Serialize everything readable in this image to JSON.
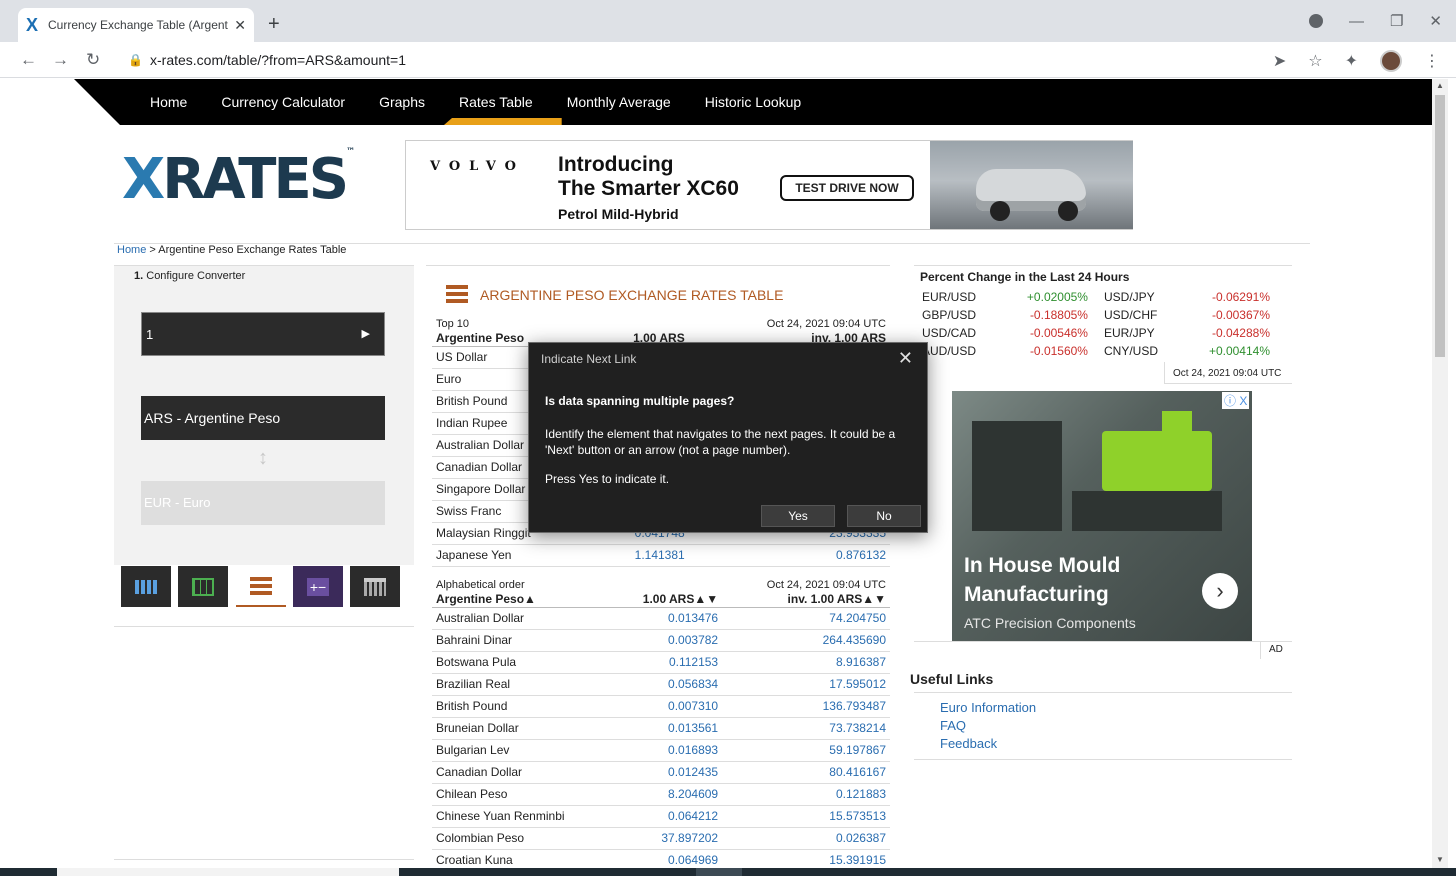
{
  "browser": {
    "tab_title": "Currency Exchange Table (Argent",
    "url": "x-rates.com/table/?from=ARS&amount=1"
  },
  "site_nav": [
    "Home",
    "Currency Calculator",
    "Graphs",
    "Rates Table",
    "Monthly Average",
    "Historic Lookup"
  ],
  "site_nav_active": "Rates Table",
  "logo": {
    "text": "RATES",
    "prefix": "X",
    "tm": "™"
  },
  "ad_banner": {
    "brand": "VOLVO",
    "headline_1": "Introducing",
    "headline_2": "The Smarter XC60",
    "cta": "TEST DRIVE NOW",
    "subline": "Petrol Mild-Hybrid"
  },
  "breadcrumb": {
    "home": "Home",
    "separator": " > ",
    "current": "Argentine Peso Exchange Rates Table"
  },
  "converter": {
    "step_num": "1.",
    "step_label": " Configure Converter",
    "amount": "1",
    "from": "ARS - Argentine Peso",
    "to": "EUR - Euro"
  },
  "rates": {
    "title": "ARGENTINE PESO EXCHANGE RATES TABLE",
    "top10": {
      "section": "Top 10",
      "timestamp": "Oct 24, 2021 09:04 UTC",
      "col_currency": "Argentine Peso",
      "col_amount": "1.00 ARS",
      "col_inv": "inv. 1.00 ARS",
      "rows": [
        [
          "US Dollar",
          "",
          ""
        ],
        [
          "Euro",
          "",
          ""
        ],
        [
          "British Pound",
          "",
          ""
        ],
        [
          "Indian Rupee",
          "",
          ""
        ],
        [
          "Australian Dollar",
          "",
          ""
        ],
        [
          "Canadian Dollar",
          "",
          ""
        ],
        [
          "Singapore Dollar",
          "",
          ""
        ],
        [
          "Swiss Franc",
          "",
          ""
        ],
        [
          "Malaysian Ringgit",
          "0.041748",
          "23.953335"
        ],
        [
          "Japanese Yen",
          "1.141381",
          "0.876132"
        ]
      ]
    },
    "alpha": {
      "section": "Alphabetical order",
      "timestamp": "Oct 24, 2021 09:04 UTC",
      "col_currency": "Argentine Peso▲",
      "col_amount": "1.00 ARS▲▼",
      "col_inv": "inv. 1.00 ARS▲▼",
      "rows": [
        [
          "Australian Dollar",
          "0.013476",
          "74.204750"
        ],
        [
          "Bahraini Dinar",
          "0.003782",
          "264.435690"
        ],
        [
          "Botswana Pula",
          "0.112153",
          "8.916387"
        ],
        [
          "Brazilian Real",
          "0.056834",
          "17.595012"
        ],
        [
          "British Pound",
          "0.007310",
          "136.793487"
        ],
        [
          "Bruneian Dollar",
          "0.013561",
          "73.738214"
        ],
        [
          "Bulgarian Lev",
          "0.016893",
          "59.197867"
        ],
        [
          "Canadian Dollar",
          "0.012435",
          "80.416167"
        ],
        [
          "Chilean Peso",
          "8.204609",
          "0.121883"
        ],
        [
          "Chinese Yuan Renminbi",
          "0.064212",
          "15.573513"
        ],
        [
          "Colombian Peso",
          "37.897202",
          "0.026387"
        ],
        [
          "Croatian Kuna",
          "0.064969",
          "15.391915"
        ]
      ]
    }
  },
  "percent_change": {
    "title": "Percent Change in the Last 24 Hours",
    "rows": [
      [
        "EUR/USD",
        "+0.02005%",
        "USD/JPY",
        "-0.06291%"
      ],
      [
        "GBP/USD",
        "-0.18805%",
        "USD/CHF",
        "-0.00367%"
      ],
      [
        "USD/CAD",
        "-0.00546%",
        "EUR/JPY",
        "-0.04288%"
      ],
      [
        "AUD/USD",
        "-0.01560%",
        "CNY/USD",
        "+0.00414%"
      ]
    ],
    "timestamp": "Oct 24, 2021 09:04 UTC"
  },
  "side_ad": {
    "title_1": "In House Mould",
    "title_2": "Manufacturing",
    "sub": "ATC Precision Components",
    "badge": "ⓘ X",
    "tag": "AD"
  },
  "useful_links": {
    "title": "Useful Links",
    "items": [
      "Euro Information",
      "FAQ",
      "Feedback"
    ]
  },
  "dialog": {
    "title": "Indicate Next Link",
    "question": "Is data spanning multiple pages?",
    "body": "Identify the element that navigates to the next pages. It could be a 'Next' button or an arrow (not a page number).",
    "press": "Press Yes to indicate it.",
    "yes": "Yes",
    "no": "No"
  },
  "colors": {
    "accent_orange": "#e8a018",
    "rates_title": "#b05a23",
    "link_blue": "#2a6db0",
    "positive": "#2f8f2f",
    "negative": "#c9302c"
  }
}
